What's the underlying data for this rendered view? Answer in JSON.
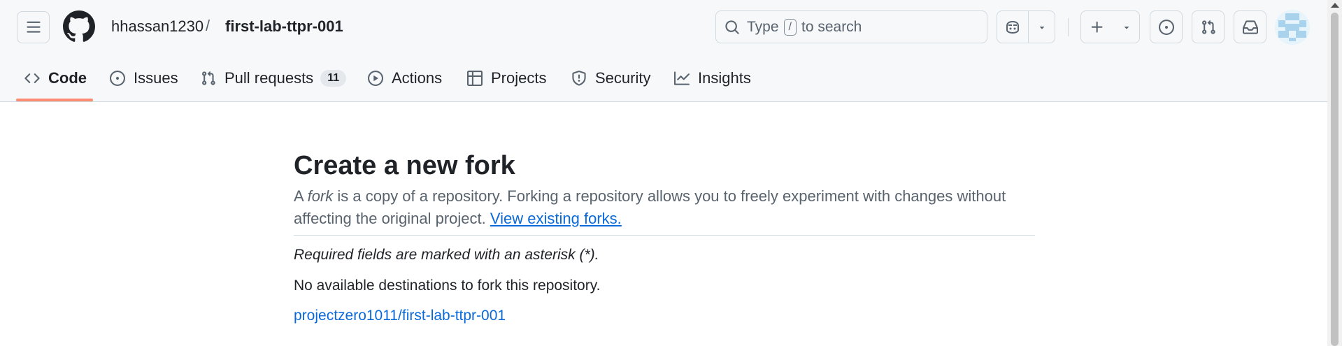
{
  "header": {
    "owner": "hhassan1230",
    "separator": "/",
    "repo": "first-lab-ttpr-001",
    "search": {
      "prefix": "Type",
      "key": "/",
      "suffix": "to search"
    }
  },
  "icons": {
    "hamburger": "three-bars-icon",
    "logo": "github-mark-icon",
    "search": "search-icon",
    "copilot": "copilot-icon",
    "create": "plus-icon",
    "issues": "issue-opened-icon",
    "pulls": "git-pull-request-icon",
    "inbox": "inbox-icon"
  },
  "tabs": [
    {
      "label": "Code",
      "icon": "code-icon",
      "selected": true
    },
    {
      "label": "Issues",
      "icon": "issue-opened-icon"
    },
    {
      "label": "Pull requests",
      "icon": "git-pull-request-icon",
      "counter": "11"
    },
    {
      "label": "Actions",
      "icon": "play-icon"
    },
    {
      "label": "Projects",
      "icon": "table-icon"
    },
    {
      "label": "Security",
      "icon": "shield-icon"
    },
    {
      "label": "Insights",
      "icon": "graph-icon"
    }
  ],
  "main": {
    "title": "Create a new fork",
    "desc_a": "A ",
    "desc_fork": "fork",
    "desc_b": " is a copy of a repository. Forking a repository allows you to freely experiment with changes without affecting the original project. ",
    "view_forks": "View existing forks.",
    "required": "Required fields are marked with an asterisk (*).",
    "no_destinations": "No available destinations to fork this repository.",
    "upstream": "projectzero1011/first-lab-ttpr-001"
  },
  "colors": {
    "accent_underline": "#fd8c73",
    "link": "#0969da",
    "header_bg": "#f6f8fa",
    "border": "#d1d9e0",
    "muted_text": "#59636e"
  }
}
